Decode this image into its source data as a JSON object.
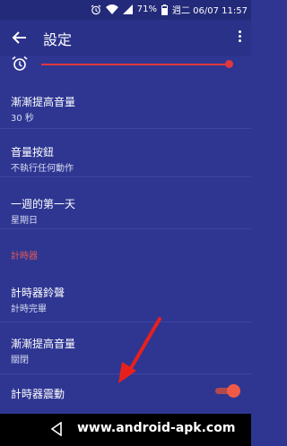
{
  "status_bar": {
    "battery_percent": "71%",
    "date_time": "週二 06/07 11:57",
    "icons": [
      "alarm-icon",
      "wifi-icon",
      "signal-icon",
      "battery-icon"
    ]
  },
  "app_bar": {
    "title": "設定",
    "icons": [
      "arrow-back-icon",
      "more-vert-icon"
    ]
  },
  "volume_slider": {
    "level": 0.97,
    "accent": "#e0383e"
  },
  "settings": {
    "items": [
      {
        "title": "漸漸提高音量",
        "summary": "30 秒"
      },
      {
        "title": "音量按鈕",
        "summary": "不執行任何動作"
      },
      {
        "title": "一週的第一天",
        "summary": "星期日"
      }
    ],
    "timer_section": {
      "header": "計時器",
      "items": [
        {
          "title": "計時器鈴聲",
          "summary": "計時完畢"
        },
        {
          "title": "漸漸提高音量",
          "summary": "關閉"
        }
      ],
      "vibrate": {
        "title": "計時器震動",
        "enabled": true
      }
    }
  },
  "watermark": "www.android-apk.com",
  "colors": {
    "background": "#2e3692",
    "accent": "#e0383e",
    "header_red": "#e35a56"
  }
}
